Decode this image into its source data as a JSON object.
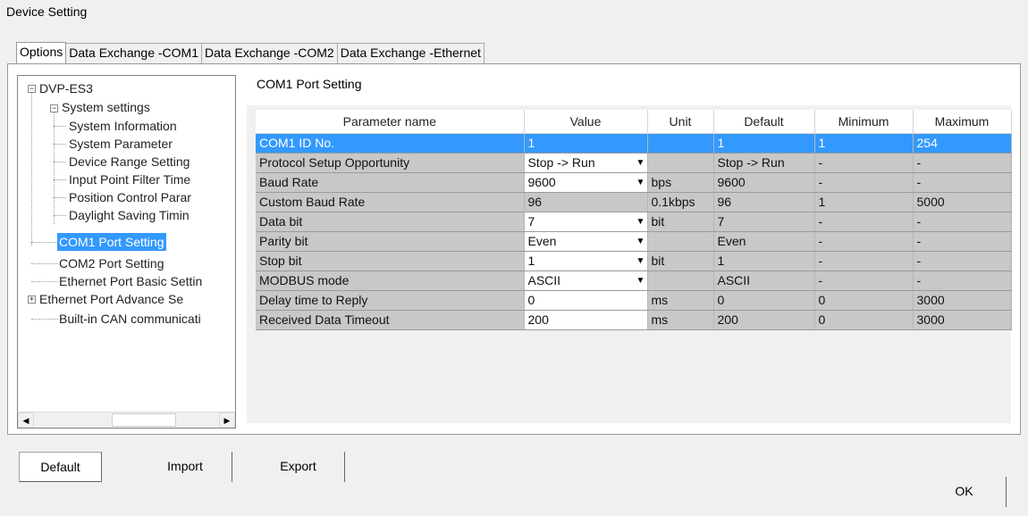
{
  "window": {
    "title": "Device Setting"
  },
  "tabs": [
    {
      "label": "Options",
      "active": true
    },
    {
      "label": "Data Exchange -COM1",
      "active": false
    },
    {
      "label": "Data Exchange -COM2",
      "active": false
    },
    {
      "label": "Data Exchange -Ethernet",
      "active": false
    }
  ],
  "tree": {
    "root": "DVP-ES3",
    "system_settings": "System settings",
    "items": [
      "System Information",
      "System Parameter",
      "Device Range Setting",
      "Input Point Filter Time",
      "Position Control Parar",
      "Daylight Saving Timin"
    ],
    "top_items": [
      "COM1 Port Setting",
      "COM2 Port Setting",
      "Ethernet Port Basic Settin",
      "Ethernet Port Advance Se",
      "Built-in CAN communicati"
    ],
    "selected": "COM1 Port Setting"
  },
  "section_title": "COM1 Port Setting",
  "grid": {
    "columns": [
      "Parameter name",
      "Value",
      "Unit",
      "Default",
      "Minimum",
      "Maximum"
    ],
    "rows": [
      {
        "name": "COM1 ID No.",
        "value": "1",
        "unit": "",
        "default": "1",
        "min": "1",
        "max": "254",
        "selected": true,
        "editable": false,
        "dropdown": false
      },
      {
        "name": "Protocol Setup Opportunity",
        "value": "Stop -> Run",
        "unit": "",
        "default": "Stop -> Run",
        "min": "-",
        "max": "-",
        "editable": true,
        "dropdown": true
      },
      {
        "name": "Baud Rate",
        "value": "9600",
        "unit": "bps",
        "default": "9600",
        "min": "-",
        "max": "-",
        "editable": true,
        "dropdown": true
      },
      {
        "name": "Custom Baud Rate",
        "value": "96",
        "unit": "0.1kbps",
        "default": "96",
        "min": "1",
        "max": "5000",
        "editable": false,
        "dropdown": false
      },
      {
        "name": "Data bit",
        "value": "7",
        "unit": "bit",
        "default": "7",
        "min": "-",
        "max": "-",
        "editable": true,
        "dropdown": true
      },
      {
        "name": "Parity bit",
        "value": "Even",
        "unit": "",
        "default": "Even",
        "min": "-",
        "max": "-",
        "editable": true,
        "dropdown": true
      },
      {
        "name": "Stop bit",
        "value": "1",
        "unit": "bit",
        "default": "1",
        "min": "-",
        "max": "-",
        "editable": true,
        "dropdown": true
      },
      {
        "name": "MODBUS mode",
        "value": "ASCII",
        "unit": "",
        "default": "ASCII",
        "min": "-",
        "max": "-",
        "editable": true,
        "dropdown": true
      },
      {
        "name": "Delay time to Reply",
        "value": "0",
        "unit": "ms",
        "default": "0",
        "min": "0",
        "max": "3000",
        "editable": true,
        "dropdown": false
      },
      {
        "name": "Received Data Timeout",
        "value": "200",
        "unit": "ms",
        "default": "200",
        "min": "0",
        "max": "3000",
        "editable": true,
        "dropdown": false
      }
    ]
  },
  "buttons": {
    "default": "Default",
    "import": "Import",
    "export": "Export",
    "ok": "OK"
  },
  "icons": {
    "collapse": "minus-box-icon",
    "expand": "plus-box-icon",
    "scroll_left": "arrow-left-icon",
    "scroll_right": "arrow-right-icon",
    "dropdown": "chevron-down-icon"
  },
  "colors": {
    "selection": "#3399ff",
    "readonly_cell": "#c8c8c8"
  }
}
